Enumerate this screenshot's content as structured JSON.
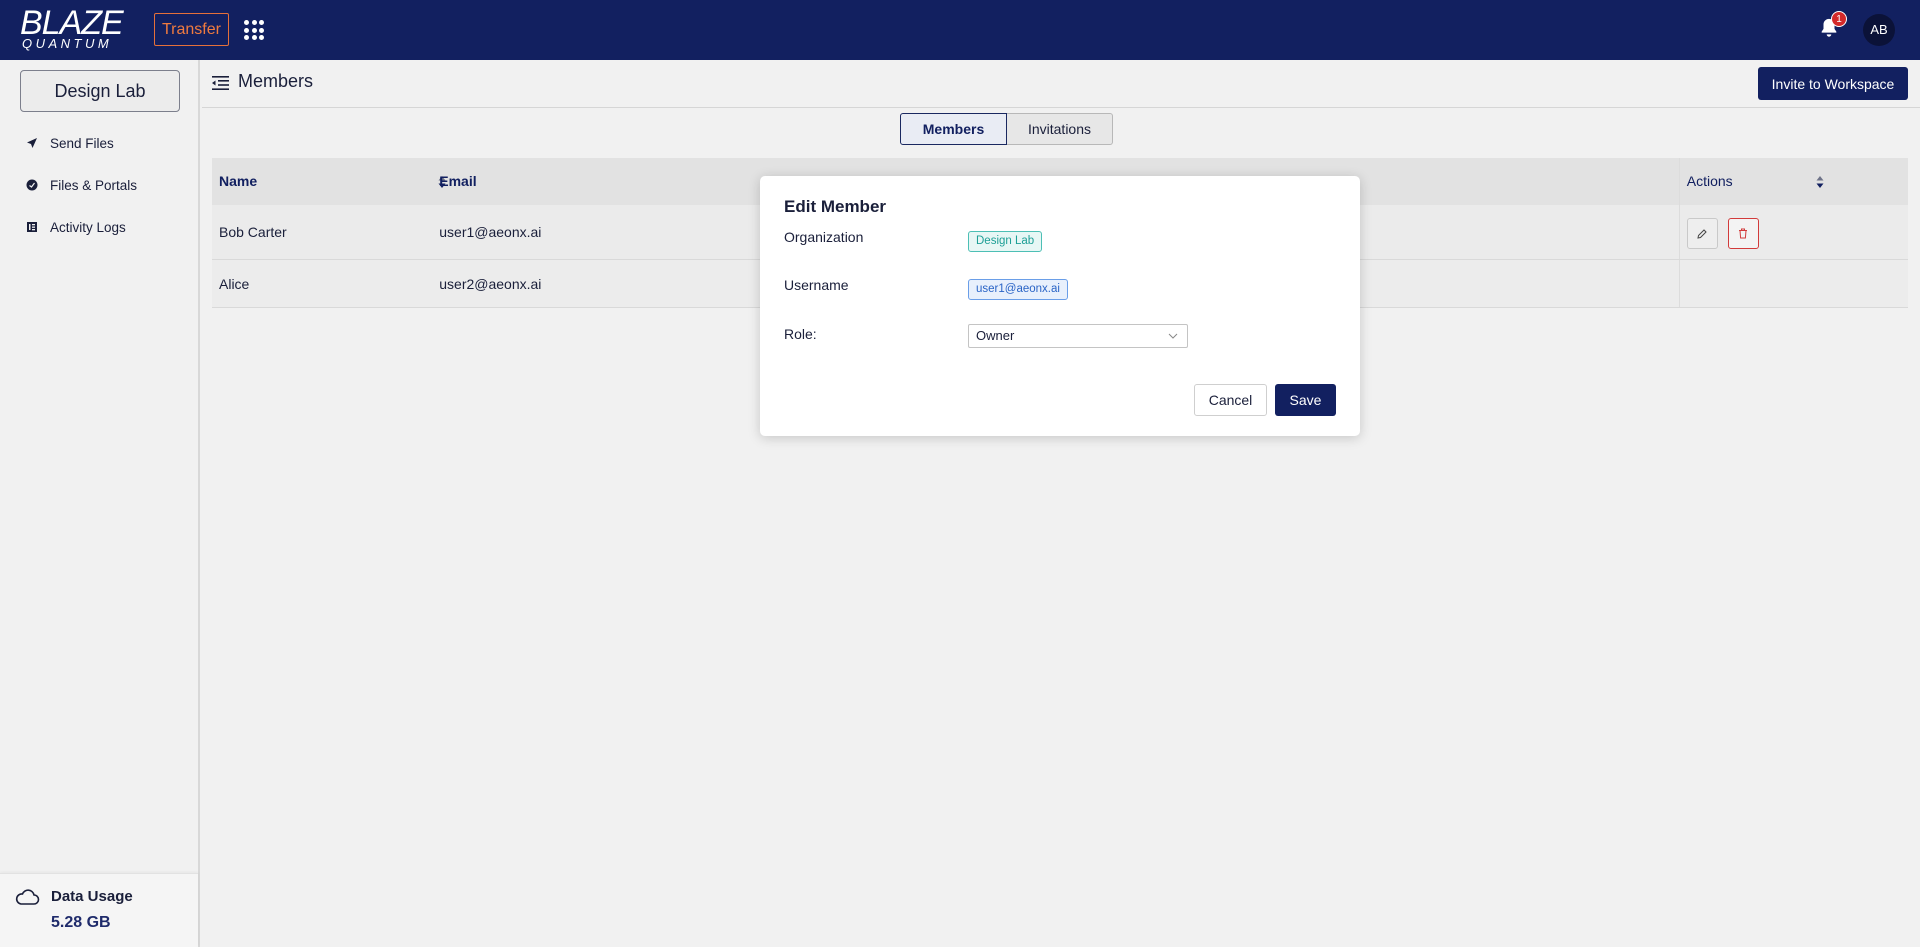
{
  "topbar": {
    "logo_main": "BLAZE",
    "logo_sub": "QUANTUM",
    "transfer_label": "Transfer",
    "notification_count": "1",
    "avatar_initials": "AB",
    "colors": {
      "bar": "#122060",
      "accent": "#f07b3f",
      "badge": "#d42a2a"
    }
  },
  "sidebar": {
    "workspace_label": "Design Lab",
    "items": [
      {
        "label": "Send Files",
        "icon": "send-icon"
      },
      {
        "label": "Files & Portals",
        "icon": "portal-icon"
      },
      {
        "label": "Activity Logs",
        "icon": "log-icon"
      }
    ],
    "usage": {
      "label": "Data Usage",
      "value": "5.28 GB",
      "icon": "cloud-icon"
    }
  },
  "header": {
    "title": "Members",
    "invite_label": "Invite to Workspace"
  },
  "tabs": [
    {
      "label": "Members",
      "active": true
    },
    {
      "label": "Invitations",
      "active": false
    }
  ],
  "table": {
    "columns": [
      "Name",
      "Email",
      "Actions"
    ],
    "rows": [
      {
        "name": "Bob Carter",
        "email": "user1@aeonx.ai"
      },
      {
        "name": "Alice",
        "email": "user2@aeonx.ai"
      }
    ]
  },
  "modal": {
    "title": "Edit Member",
    "org_label": "Organization",
    "org_value": "Design Lab",
    "username_label": "Username",
    "username_value": "user1@aeonx.ai",
    "role_label": "Role:",
    "role_value": "Owner",
    "cancel_label": "Cancel",
    "save_label": "Save"
  }
}
